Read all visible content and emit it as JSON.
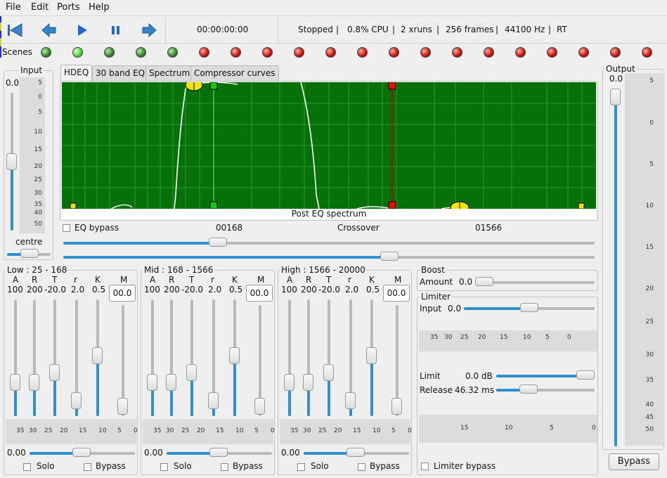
{
  "menu": {
    "file": "File",
    "edit": "Edit",
    "ports": "Ports",
    "help": "Help"
  },
  "toolbar": {
    "time": "00:00:00:00",
    "status": "Stopped",
    "cpu": "0.8% CPU",
    "xruns": "2 xruns",
    "frames": "256 frames",
    "rate": "44100 Hz",
    "rt": "RT",
    "sep": "|"
  },
  "scenes": {
    "label": "Scenes",
    "states": [
      "green",
      "green-lit",
      "green",
      "green",
      "green",
      "red",
      "red",
      "red",
      "red",
      "red",
      "red",
      "red",
      "red",
      "red",
      "red",
      "red",
      "red",
      "red",
      "red",
      "red"
    ]
  },
  "input": {
    "title": "Input",
    "value": "0.0",
    "centre": "centre",
    "ticks": [
      "5",
      "0",
      "5",
      "10",
      "15",
      "20",
      "25",
      "30",
      "35",
      "40",
      "50"
    ]
  },
  "output": {
    "title": "Output",
    "value": "0.0",
    "ticks": [
      "5",
      "0",
      "5",
      "10",
      "15",
      "20",
      "25",
      "30",
      "35",
      "40",
      "45",
      "50"
    ],
    "bypass": "Bypass"
  },
  "tabs": [
    "HDEQ",
    "30 band EQ",
    "Spectrum",
    "Compressor curves"
  ],
  "eq": {
    "caption": "Post EQ spectrum",
    "bypass": "EQ bypass",
    "low_xover": "00168",
    "crossover": "Crossover",
    "high_xover": "01566",
    "bg": "#086808"
  },
  "bands": [
    {
      "title": "Low : 25 - 168",
      "params": [
        "A",
        "R",
        "T",
        "r",
        "K",
        "M"
      ],
      "values": [
        "100",
        "200",
        "-20.0",
        "2.0",
        "0.5"
      ],
      "m_value": "00.0",
      "ticks": [
        "35",
        "30",
        "25",
        "20",
        "15",
        "10",
        "5",
        "0"
      ],
      "gain": "0.00",
      "solo": "Solo",
      "bypass": "Bypass"
    },
    {
      "title": "Mid : 168 - 1566",
      "params": [
        "A",
        "R",
        "T",
        "r",
        "K",
        "M"
      ],
      "values": [
        "100",
        "200",
        "-20.0",
        "2.0",
        "0.5"
      ],
      "m_value": "00.0",
      "ticks": [
        "35",
        "30",
        "25",
        "20",
        "15",
        "10",
        "5",
        "0"
      ],
      "gain": "0.00",
      "solo": "Solo",
      "bypass": "Bypass"
    },
    {
      "title": "High : 1566 - 20000",
      "params": [
        "A",
        "R",
        "T",
        "r",
        "K",
        "M"
      ],
      "values": [
        "100",
        "200",
        "-20.0",
        "2.0",
        "0.5"
      ],
      "m_value": "00.0",
      "ticks": [
        "35",
        "30",
        "25",
        "20",
        "15",
        "10",
        "5",
        "0"
      ],
      "gain": "0.00",
      "solo": "Solo",
      "bypass": "Bypass"
    }
  ],
  "boost": {
    "title": "Boost",
    "amount_label": "Amount",
    "amount": "0.0"
  },
  "limiter": {
    "title": "Limiter",
    "input_label": "Input",
    "input": "0.0",
    "ticks": [
      "35",
      "30",
      "25",
      "20",
      "15",
      "10",
      "5",
      "0"
    ],
    "limit_label": "Limit",
    "limit": "0.0 dB",
    "release_label": "Release",
    "release": "46.32 ms",
    "gr_ticks": [
      "15",
      "10",
      "5",
      "0"
    ],
    "bypass": "Limiter bypass"
  }
}
